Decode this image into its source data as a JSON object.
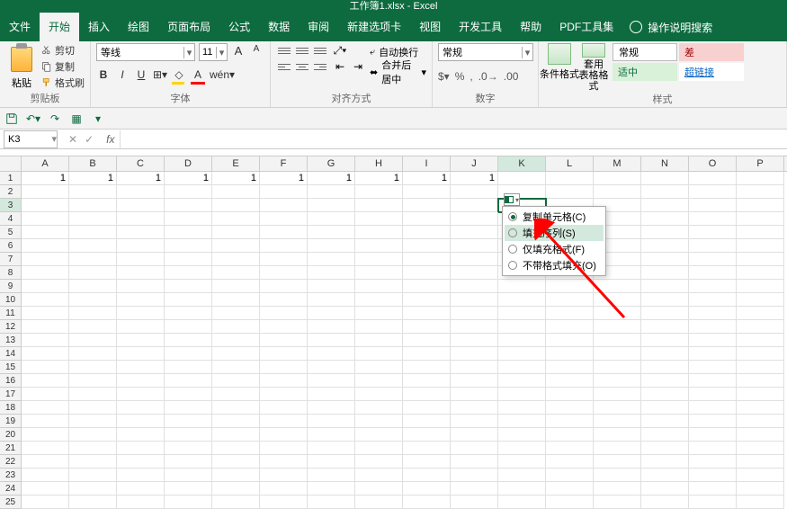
{
  "title": "工作簿1.xlsx - Excel",
  "tabs": [
    "文件",
    "开始",
    "插入",
    "绘图",
    "页面布局",
    "公式",
    "数据",
    "审阅",
    "新建选项卡",
    "视图",
    "开发工具",
    "帮助",
    "PDF工具集"
  ],
  "active_tab_index": 1,
  "search_placeholder": "操作说明搜索",
  "clipboard": {
    "paste": "粘贴",
    "cut": "剪切",
    "copy": "复制",
    "brush": "格式刷",
    "group": "剪贴板"
  },
  "font": {
    "name": "等线",
    "size": "11",
    "aa_up": "A",
    "aa_dn": "A",
    "bold": "B",
    "italic": "I",
    "under": "U",
    "group": "字体"
  },
  "alignment": {
    "wrap": "自动换行",
    "merge": "合并后居中",
    "group": "对齐方式"
  },
  "number": {
    "format": "常规",
    "group": "数字"
  },
  "styles": {
    "cond": "条件格式",
    "table": "套用\n表格格式",
    "normal": "常规",
    "bad": "差",
    "neutral": "适中",
    "link": "超链接",
    "group": "样式"
  },
  "name_box": "K3",
  "columns": [
    "A",
    "B",
    "C",
    "D",
    "E",
    "F",
    "G",
    "H",
    "I",
    "J",
    "K",
    "L",
    "M",
    "N",
    "O",
    "P"
  ],
  "row_count": 25,
  "row1_values": {
    "A": "1",
    "B": "1",
    "C": "1",
    "D": "1",
    "E": "1",
    "F": "1",
    "G": "1",
    "H": "1",
    "I": "1",
    "J": "1"
  },
  "selected_cell": "K3",
  "autofill_menu": {
    "copy_cells": "复制单元格(C)",
    "fill_series": "填充序列(S)",
    "fill_format": "仅填充格式(F)",
    "no_format": "不带格式填充(O)",
    "selected_index": 0,
    "hover_index": 1
  }
}
